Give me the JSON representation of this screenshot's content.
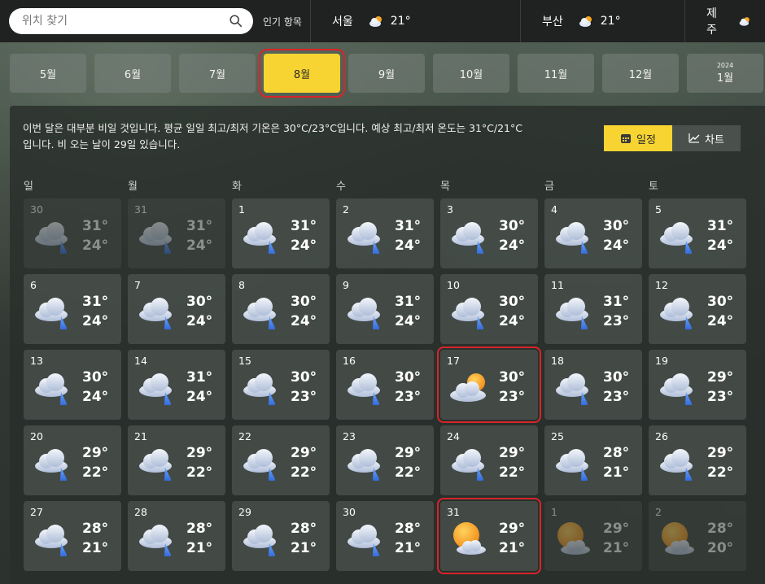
{
  "search": {
    "placeholder": "위치 찾기"
  },
  "topbar": {
    "popular_label": "인기 항목",
    "cities": [
      {
        "name": "서울",
        "temp": "21°",
        "icon": "cloudy-sun-icon"
      },
      {
        "name": "부산",
        "temp": "21°",
        "icon": "cloudy-sun-icon"
      },
      {
        "name": "제주",
        "temp": "",
        "icon": "cloudy-sun-icon"
      }
    ]
  },
  "months": [
    {
      "label": "5월",
      "year": ""
    },
    {
      "label": "6월",
      "year": ""
    },
    {
      "label": "7월",
      "year": ""
    },
    {
      "label": "8월",
      "year": "",
      "active": true
    },
    {
      "label": "9월",
      "year": ""
    },
    {
      "label": "10월",
      "year": ""
    },
    {
      "label": "11월",
      "year": ""
    },
    {
      "label": "12월",
      "year": ""
    },
    {
      "label": "1월",
      "year": "2024"
    }
  ],
  "summary": "이번 달은 대부분 비일 것입니다. 평균 일일 최고/최저 기온은 30°C/23°C입니다. 예상 최고/최저 온도는 31°C/21°C입니다. 비 오는 날이 29일 있습니다.",
  "view_toggle": {
    "calendar": "일정",
    "chart": "차트"
  },
  "weekdays": [
    "일",
    "월",
    "화",
    "수",
    "목",
    "금",
    "토"
  ],
  "days": [
    {
      "day": "30",
      "hi": "31°",
      "lo": "24°",
      "icon": "rain",
      "dim": true
    },
    {
      "day": "31",
      "hi": "31°",
      "lo": "24°",
      "icon": "rain",
      "dim": true
    },
    {
      "day": "1",
      "hi": "31°",
      "lo": "24°",
      "icon": "rain"
    },
    {
      "day": "2",
      "hi": "31°",
      "lo": "24°",
      "icon": "rain"
    },
    {
      "day": "3",
      "hi": "30°",
      "lo": "24°",
      "icon": "rain"
    },
    {
      "day": "4",
      "hi": "30°",
      "lo": "24°",
      "icon": "rain"
    },
    {
      "day": "5",
      "hi": "31°",
      "lo": "24°",
      "icon": "rain"
    },
    {
      "day": "6",
      "hi": "31°",
      "lo": "24°",
      "icon": "rain"
    },
    {
      "day": "7",
      "hi": "30°",
      "lo": "24°",
      "icon": "rain"
    },
    {
      "day": "8",
      "hi": "30°",
      "lo": "24°",
      "icon": "rain"
    },
    {
      "day": "9",
      "hi": "31°",
      "lo": "24°",
      "icon": "rain"
    },
    {
      "day": "10",
      "hi": "30°",
      "lo": "24°",
      "icon": "rain"
    },
    {
      "day": "11",
      "hi": "31°",
      "lo": "23°",
      "icon": "rain"
    },
    {
      "day": "12",
      "hi": "30°",
      "lo": "24°",
      "icon": "rain"
    },
    {
      "day": "13",
      "hi": "30°",
      "lo": "24°",
      "icon": "rain"
    },
    {
      "day": "14",
      "hi": "31°",
      "lo": "24°",
      "icon": "rain"
    },
    {
      "day": "15",
      "hi": "30°",
      "lo": "23°",
      "icon": "rain"
    },
    {
      "day": "16",
      "hi": "30°",
      "lo": "23°",
      "icon": "rain"
    },
    {
      "day": "17",
      "hi": "30°",
      "lo": "23°",
      "icon": "partly-cloudy",
      "framed": true
    },
    {
      "day": "18",
      "hi": "30°",
      "lo": "23°",
      "icon": "rain"
    },
    {
      "day": "19",
      "hi": "29°",
      "lo": "23°",
      "icon": "rain"
    },
    {
      "day": "20",
      "hi": "29°",
      "lo": "22°",
      "icon": "rain"
    },
    {
      "day": "21",
      "hi": "29°",
      "lo": "22°",
      "icon": "rain"
    },
    {
      "day": "22",
      "hi": "29°",
      "lo": "22°",
      "icon": "rain"
    },
    {
      "day": "23",
      "hi": "29°",
      "lo": "22°",
      "icon": "rain"
    },
    {
      "day": "24",
      "hi": "29°",
      "lo": "22°",
      "icon": "rain"
    },
    {
      "day": "25",
      "hi": "28°",
      "lo": "21°",
      "icon": "rain"
    },
    {
      "day": "26",
      "hi": "29°",
      "lo": "22°",
      "icon": "rain"
    },
    {
      "day": "27",
      "hi": "28°",
      "lo": "21°",
      "icon": "rain"
    },
    {
      "day": "28",
      "hi": "28°",
      "lo": "21°",
      "icon": "rain"
    },
    {
      "day": "29",
      "hi": "28°",
      "lo": "21°",
      "icon": "rain"
    },
    {
      "day": "30",
      "hi": "28°",
      "lo": "21°",
      "icon": "rain"
    },
    {
      "day": "31",
      "hi": "29°",
      "lo": "21°",
      "icon": "sun-cloud",
      "framed": true
    },
    {
      "day": "1",
      "hi": "29°",
      "lo": "21°",
      "icon": "sun-cloud",
      "dim": true
    },
    {
      "day": "2",
      "hi": "28°",
      "lo": "20°",
      "icon": "sun-cloud",
      "dim": true
    }
  ]
}
